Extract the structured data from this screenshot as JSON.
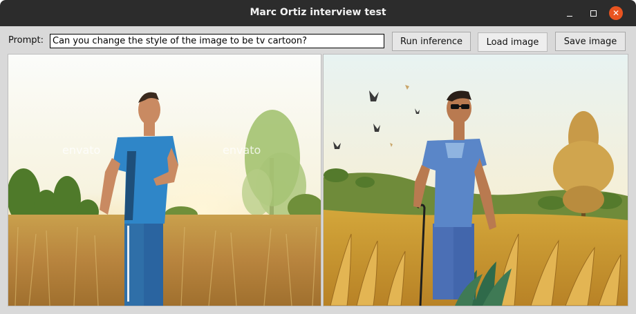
{
  "window": {
    "title": "Marc Ortiz interview test"
  },
  "window_controls": {
    "minimize_icon": "minimize-icon",
    "maximize_icon": "maximize-icon",
    "close_icon": "close-icon",
    "close_color": "#e95420"
  },
  "toolbar": {
    "prompt_label": "Prompt:",
    "prompt_value": "Can you change the style of the image to be tv cartoon?",
    "run_label": "Run inference",
    "load_label": "Load image",
    "save_label": "Save image"
  },
  "images": {
    "input_watermark_1": "envato",
    "input_watermark_2": "envato"
  },
  "colors": {
    "titlebar": "#2c2c2c",
    "window_bg": "#d9d9d9",
    "button_bg": "#e6e6e6"
  }
}
